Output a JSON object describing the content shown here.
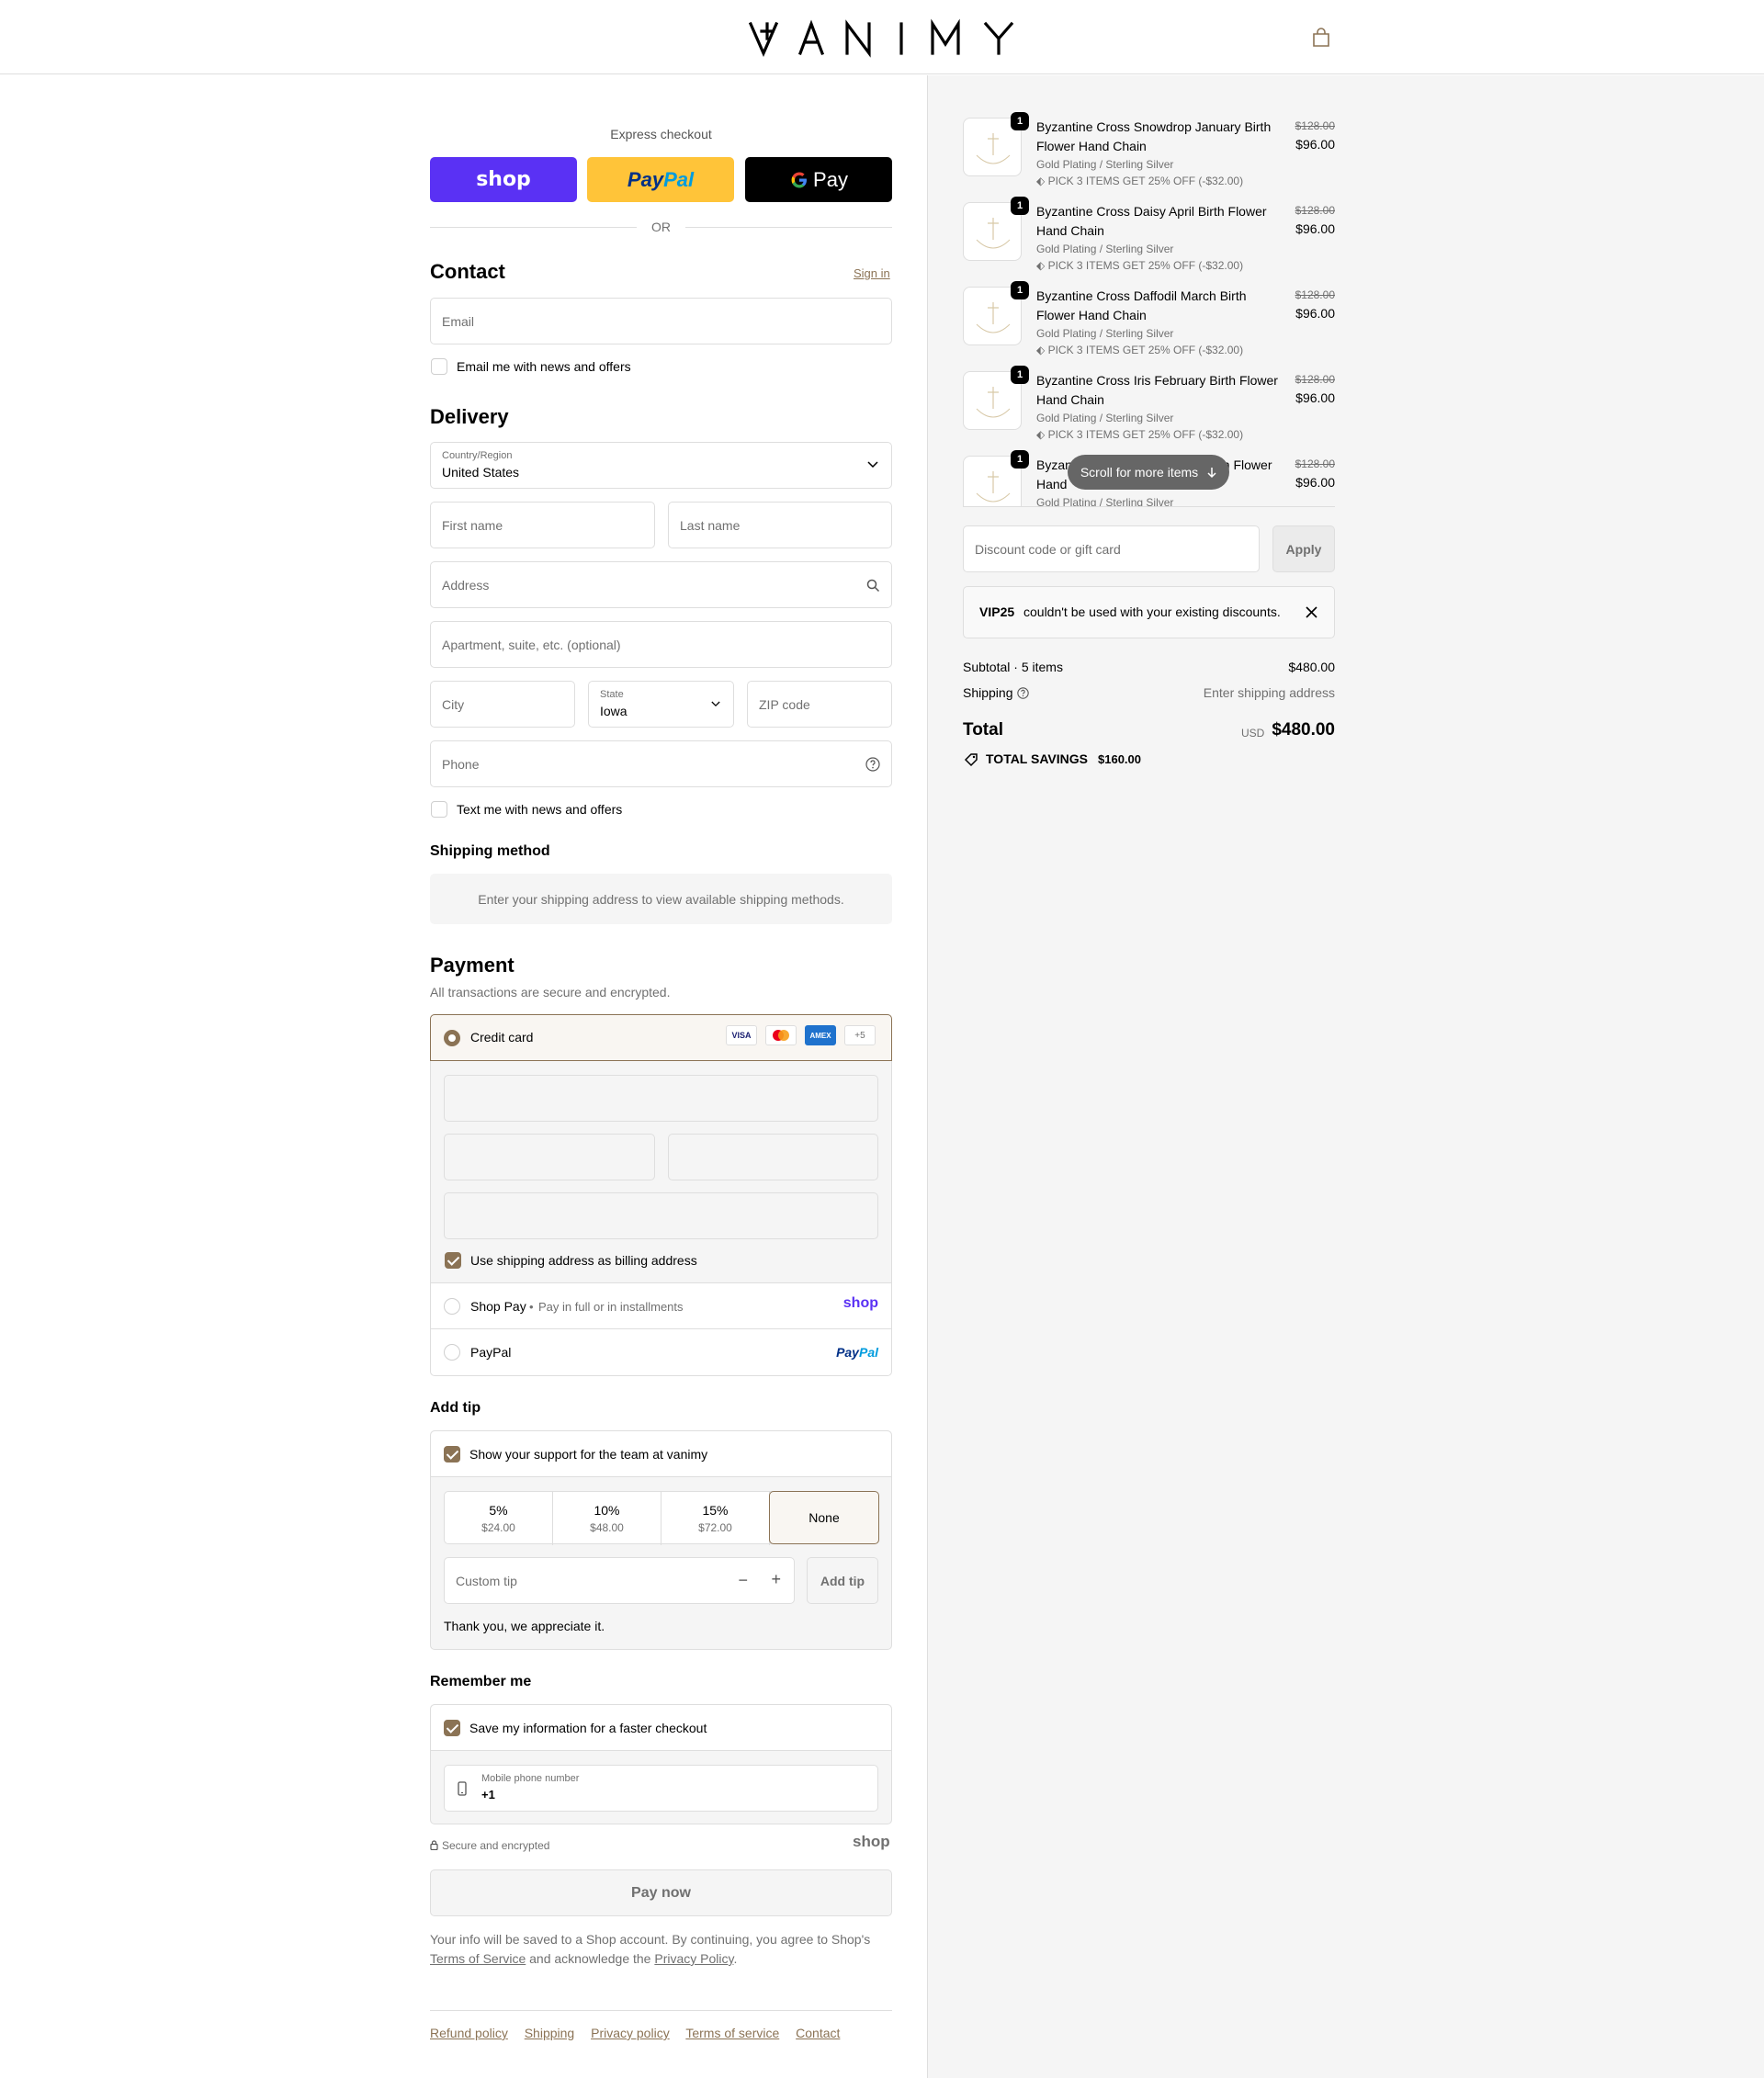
{
  "header": {
    "brand": "VANIMY",
    "cart_icon": "bag-icon"
  },
  "express": {
    "title": "Express checkout",
    "shop_label": "shop",
    "paypal_label_1": "Pay",
    "paypal_label_2": "Pal",
    "gpay_label": "Pay",
    "or": "OR",
    "colors": {
      "shop": "#5a31f4",
      "paypal": "#ffc439",
      "gpay": "#000000"
    }
  },
  "contact": {
    "heading": "Contact",
    "signin": "Sign in",
    "email_placeholder": "Email",
    "news_label": "Email me with news and offers"
  },
  "delivery": {
    "heading": "Delivery",
    "country_label": "Country/Region",
    "country_value": "United States",
    "first_name": "First name",
    "last_name": "Last name",
    "address": "Address",
    "apartment": "Apartment, suite, etc. (optional)",
    "city": "City",
    "state_label": "State",
    "state_value": "Iowa",
    "zip": "ZIP code",
    "phone": "Phone",
    "text_label": "Text me with news and offers"
  },
  "shipping_method": {
    "heading": "Shipping method",
    "message": "Enter your shipping address to view available shipping methods."
  },
  "payment": {
    "heading": "Payment",
    "subtitle": "All transactions are secure and encrypted.",
    "credit_card": "Credit card",
    "card_icons": [
      "VISA",
      "",
      "AMEX",
      "+5"
    ],
    "billing_label": "Use shipping address as billing address",
    "shop_pay": "Shop Pay",
    "shop_pay_sub": "Pay in full or in installments",
    "shop_logo": "shop",
    "paypal": "PayPal",
    "paypal_logo_1": "Pay",
    "paypal_logo_2": "Pal"
  },
  "tip": {
    "heading": "Add tip",
    "support_label": "Show your support for the team at vanimy",
    "options": [
      {
        "pct": "5%",
        "amt": "$24.00"
      },
      {
        "pct": "10%",
        "amt": "$48.00"
      },
      {
        "pct": "15%",
        "amt": "$72.00"
      },
      {
        "pct": "None",
        "amt": ""
      }
    ],
    "custom_placeholder": "Custom tip",
    "add_button": "Add tip",
    "thanks": "Thank you, we appreciate it."
  },
  "remember": {
    "heading": "Remember me",
    "save_label": "Save my information for a faster checkout",
    "phone_label": "Mobile phone number",
    "phone_value": "+1",
    "secure": "Secure and encrypted",
    "shop_logo": "shop"
  },
  "pay_now": "Pay now",
  "legal": {
    "text_1": "Your info will be saved to a Shop account. By continuing, you agree to Shop's",
    "tos": "Terms of Service",
    "text_2": "and acknowledge the",
    "privacy": "Privacy Policy",
    "text_3": "."
  },
  "footer_links": [
    "Refund policy",
    "Shipping",
    "Privacy policy",
    "Terms of service",
    "Contact"
  ],
  "cart": {
    "items": [
      {
        "qty": "1",
        "name": "Byzantine Cross Snowdrop January Birth Flower Hand Chain",
        "variant": "Gold Plating / Sterling Silver",
        "discount": "PICK 3 ITEMS GET 25% OFF (-$32.00)",
        "old_price": "$128.00",
        "price": "$96.00"
      },
      {
        "qty": "1",
        "name": "Byzantine Cross Daisy April Birth Flower Hand Chain",
        "variant": "Gold Plating / Sterling Silver",
        "discount": "PICK 3 ITEMS GET 25% OFF (-$32.00)",
        "old_price": "$128.00",
        "price": "$96.00"
      },
      {
        "qty": "1",
        "name": "Byzantine Cross Daffodil March Birth Flower Hand Chain",
        "variant": "Gold Plating / Sterling Silver",
        "discount": "PICK 3 ITEMS GET 25% OFF (-$32.00)",
        "old_price": "$128.00",
        "price": "$96.00"
      },
      {
        "qty": "1",
        "name": "Byzantine Cross Iris February Birth Flower Hand Chain",
        "variant": "Gold Plating / Sterling Silver",
        "discount": "PICK 3 ITEMS GET 25% OFF (-$32.00)",
        "old_price": "$128.00",
        "price": "$96.00"
      },
      {
        "qty": "1",
        "name_a": "Byzan",
        "name_b": "th Flower",
        "name_c": "Hand",
        "variant": "Gold Plating / Sterling Silver",
        "old_price": "$128.00",
        "price": "$96.00"
      }
    ],
    "scroll_hint": "Scroll for more items",
    "discount_placeholder": "Discount code or gift card",
    "apply": "Apply",
    "error_code": "VIP25",
    "error_text": "couldn't be used with your existing discounts.",
    "subtotal_label": "Subtotal · 5 items",
    "subtotal_value": "$480.00",
    "shipping_label": "Shipping",
    "shipping_value": "Enter shipping address",
    "total_label": "Total",
    "currency": "USD",
    "total_value": "$480.00",
    "savings_label": "TOTAL SAVINGS",
    "savings_value": "$160.00"
  },
  "theme": {
    "accent": "#8b7355",
    "link": "#8b7355",
    "panel": "#f5f5f5"
  }
}
